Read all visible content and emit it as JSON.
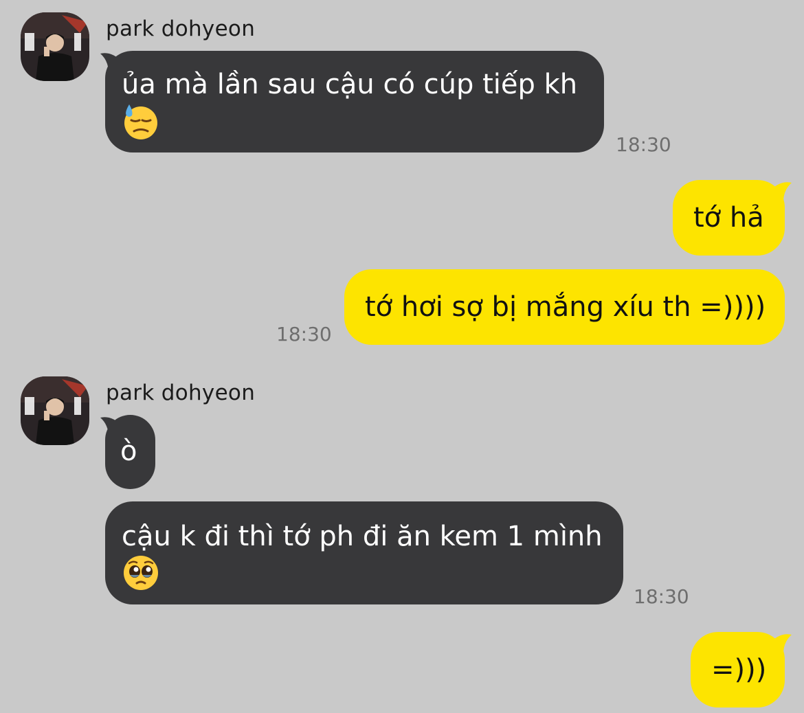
{
  "conversation": {
    "sender_name": "park dohyeon",
    "messages": [
      {
        "direction": "incoming",
        "text": "ủa mà lần sau cậu có cúp tiếp kh",
        "emoji": "downcast-face-with-sweat",
        "time": "18:30"
      },
      {
        "direction": "outgoing",
        "text": "tớ hả"
      },
      {
        "direction": "outgoing",
        "text": "tớ hơi sợ bị mắng xíu th =))))",
        "time": "18:30"
      },
      {
        "direction": "incoming",
        "text": "ò"
      },
      {
        "direction": "incoming",
        "text": "cậu k đi thì tớ ph đi ăn kem 1 mình",
        "emoji": "pleading-face",
        "time": "18:30"
      },
      {
        "direction": "outgoing",
        "text": "=)))"
      }
    ]
  },
  "colors": {
    "background": "#c9c9c9",
    "incoming_bubble": "#38383a",
    "outgoing_bubble": "#fde400"
  }
}
